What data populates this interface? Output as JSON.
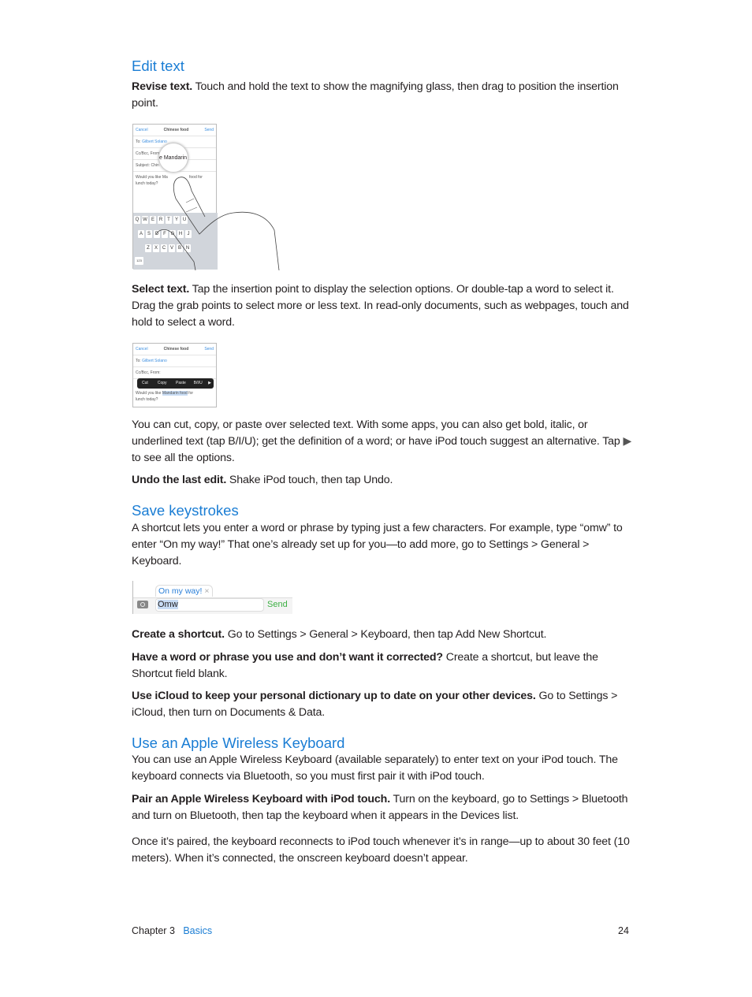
{
  "sections": [
    {
      "heading": "Edit text"
    },
    {
      "heading": "Save keystrokes"
    },
    {
      "heading": "Use an Apple Wireless Keyboard"
    }
  ],
  "paras": {
    "revise": {
      "bold": "Revise text.",
      "text": " Touch and hold the text to show the magnifying glass, then drag to position the insertion point."
    },
    "select": {
      "bold": "Select text.",
      "text": " Tap the insertion point to display the selection options. Or double-tap a word to select it. Drag the grab points to select more or less text. In read-only documents, such as webpages, touch and hold to select a word."
    },
    "cut_a": "You can cut, copy, or paste over selected text. With some apps, you can also get bold, italic, or underlined text (tap B/I/U); get the definition of a word; or have iPod touch suggest an alternative. Tap ",
    "cut_b": " to see all the options.",
    "undo": {
      "bold": "Undo the last edit.",
      "text": " Shake iPod touch, then tap Undo."
    },
    "shortcut": "A shortcut lets you enter a word or phrase by typing just a few characters. For example, type “omw” to enter “On my way!” That one’s already set up for you—to add more, go to Settings > General > Keyboard.",
    "create": {
      "bold": "Create a shortcut.",
      "text": " Go to Settings > General > Keyboard, then tap Add New Shortcut."
    },
    "have": {
      "bold": "Have a word or phrase you use and don’t want it corrected?",
      "text": " Create a shortcut, but leave the Shortcut field blank."
    },
    "icloud": {
      "bold": "Use iCloud to keep your personal dictionary up to date on your other devices.",
      "text": " Go to Settings > iCloud, then turn on Documents & Data."
    },
    "wireless": "You can use an Apple Wireless Keyboard (available separately) to enter text on your iPod touch. The keyboard connects via Bluetooth, so you must first pair it with iPod touch.",
    "pair": {
      "bold": "Pair an Apple Wireless Keyboard with iPod touch.",
      "text": " Turn on the keyboard, go to Settings > Bluetooth and turn on Bluetooth, then tap the keyboard when it appears in the Devices list."
    },
    "once": "Once it’s paired, the keyboard reconnects to iPod touch whenever it’s in range—up to about 30 feet (10 meters). When it’s connected, the onscreen keyboard doesn’t appear."
  },
  "mail": {
    "cancel": "Cancel",
    "title": "Chinese food",
    "send": "Send",
    "to": "To:",
    "to_name": "Gilbert Solano",
    "cc": "Cc/Bcc, From:",
    "subject": "Subject: Chin",
    "body1": "Would you like Ma",
    "body1b": "food for",
    "body2": "lunch today?",
    "magnifier": "e Mandarin fo",
    "sel_before": "Would you like ",
    "sel_word": "Mandarin food",
    "sel_after": " for"
  },
  "keys": {
    "row1": [
      "Q",
      "W",
      "E",
      "R",
      "T",
      "Y",
      "U"
    ],
    "row2": [
      "A",
      "S",
      "D",
      "F",
      "G",
      "H",
      "J"
    ],
    "row3": [
      "Z",
      "X",
      "C",
      "V",
      "B",
      "N"
    ],
    "num": "123"
  },
  "menu": [
    "Cut",
    "Copy",
    "Paste",
    "B/I/U"
  ],
  "shortcut_ui": {
    "suggestion": "On my way!",
    "typed": "Omw",
    "send": "Send"
  },
  "footer": {
    "chapter": "Chapter  3",
    "chapter_name": "Basics",
    "page": "24"
  },
  "colors": {
    "heading": "#1a7dd4",
    "send_green": "#3cb043"
  }
}
